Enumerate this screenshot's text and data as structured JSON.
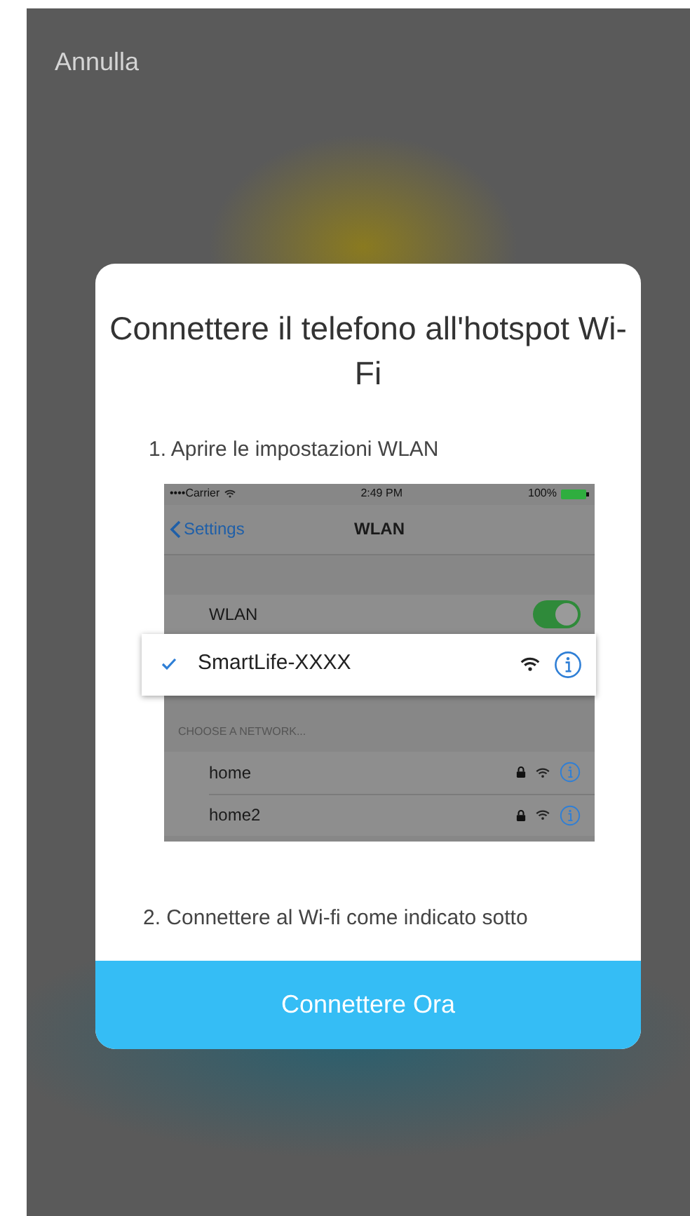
{
  "cancel": "Annulla",
  "dialog": {
    "title": "Connettere il telefono all'hotspot Wi-Fi",
    "steps": [
      "1. Aprire le impostazioni WLAN",
      "2. Connettere al Wi-fi come indicato sotto"
    ],
    "illustration": {
      "status_bar": {
        "carrier": "••••Carrier",
        "time": "2:49 PM",
        "battery": "100%"
      },
      "nav": {
        "back": "Settings",
        "title": "WLAN"
      },
      "wlan": {
        "label": "WLAN",
        "on": true
      },
      "connected": {
        "name": "SmartLife-XXXX",
        "checked": true
      },
      "section": "CHOOSE A NETWORK...",
      "networks": [
        {
          "name": "home",
          "locked": true
        },
        {
          "name": "home2",
          "locked": true
        }
      ]
    },
    "button": "Connettere Ora"
  }
}
